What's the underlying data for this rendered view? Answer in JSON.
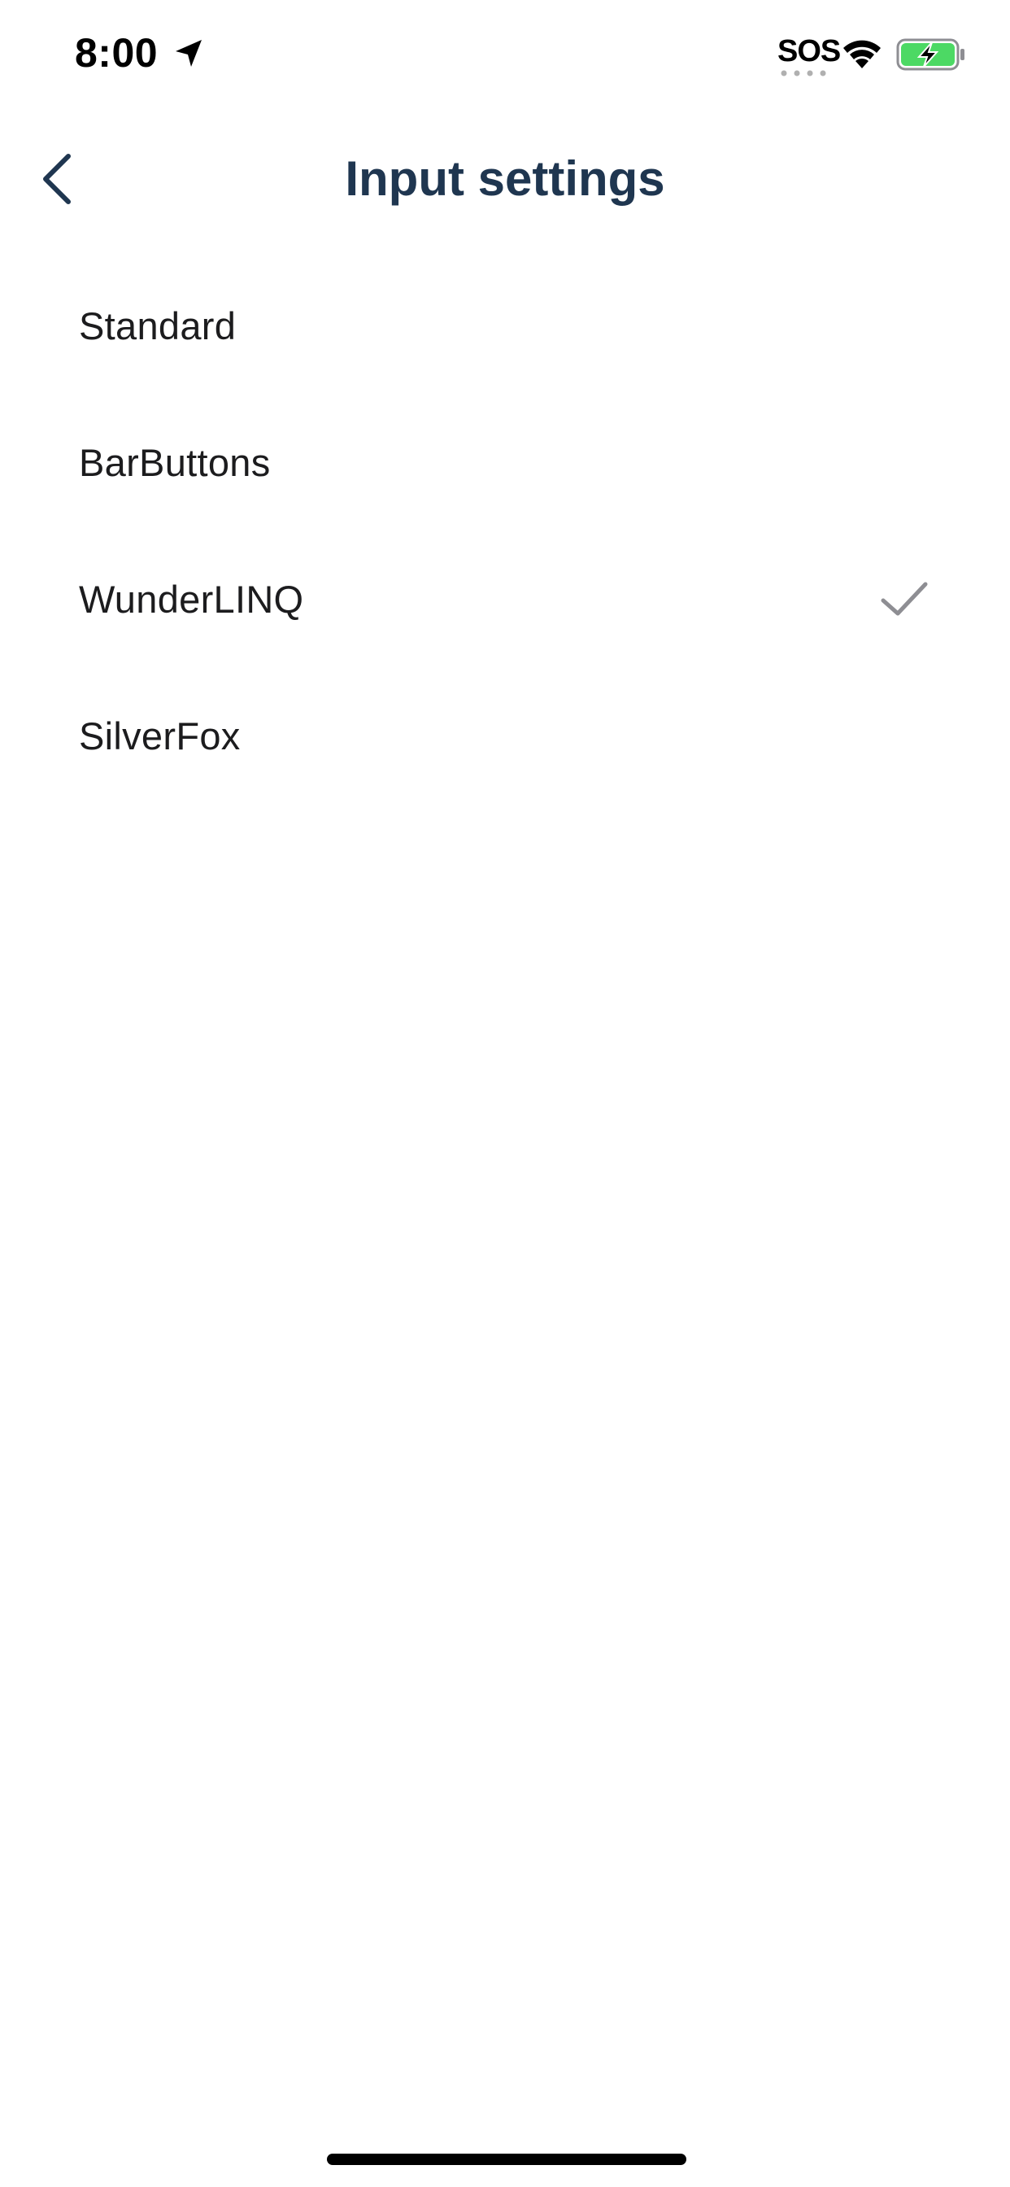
{
  "status_bar": {
    "time": "8:00",
    "sos": "SOS",
    "location_icon": "location-arrow-icon",
    "wifi_icon": "wifi-icon",
    "battery_icon": "battery-charging-icon",
    "battery_color": "#4cd964"
  },
  "nav": {
    "back_icon": "chevron-left-icon",
    "title": "Input settings",
    "title_color": "#1f3650"
  },
  "options": [
    {
      "label": "Standard",
      "selected": false
    },
    {
      "label": "BarButtons",
      "selected": false
    },
    {
      "label": "WunderLINQ",
      "selected": true
    },
    {
      "label": "SilverFox",
      "selected": false
    }
  ],
  "selected_indicator_icon": "checkmark-icon",
  "checkmark_color": "#8e8e93"
}
